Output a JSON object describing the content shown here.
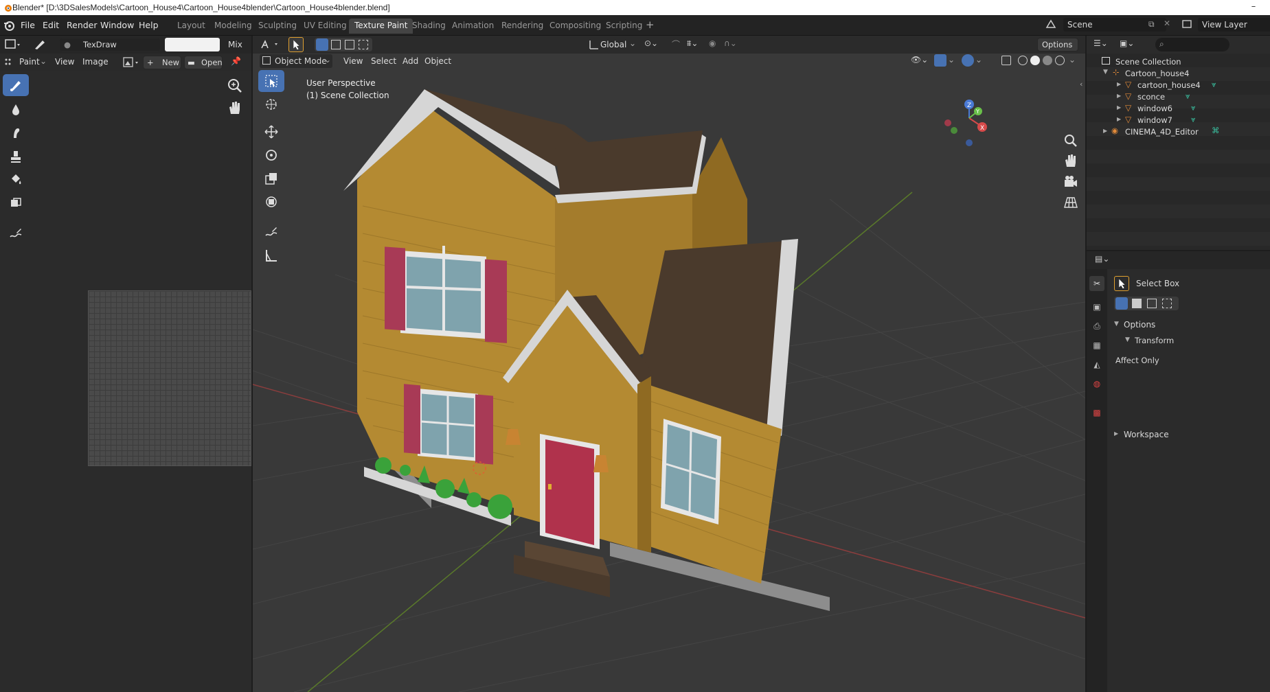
{
  "window": {
    "title": "Blender* [D:\\3DSalesModels\\Cartoon_House4\\Cartoon_House4blender\\Cartoon_House4blender.blend]",
    "minimize": "–"
  },
  "menu": [
    "File",
    "Edit",
    "Render",
    "Window",
    "Help"
  ],
  "workspaces": [
    "Layout",
    "Modeling",
    "Sculpting",
    "UV Editing",
    "Texture Paint",
    "Shading",
    "Animation",
    "Rendering",
    "Compositing",
    "Scripting"
  ],
  "workspace_active": "Texture Paint",
  "add_workspace": "+",
  "scene_name": "Scene",
  "view_layer": "View Layer",
  "image_editor": {
    "brush_name": "TexDraw",
    "blend_mode": "Mix",
    "mode": "Paint",
    "view": "View",
    "image": "Image",
    "new": "New",
    "open": "Open"
  },
  "viewport": {
    "object_mode": "Object Mode",
    "menus": [
      "View",
      "Select",
      "Add",
      "Object"
    ],
    "transform_orientation": "Global",
    "options": "Options",
    "overlay_line1": "User Perspective",
    "overlay_line2": "(1) Scene Collection",
    "gizmo_axes": {
      "x": "X",
      "y": "Y",
      "z": "Z"
    }
  },
  "outliner": {
    "root": "Scene Collection",
    "items": [
      {
        "label": "Cartoon_house4",
        "level": 1
      },
      {
        "label": "cartoon_house4",
        "level": 2
      },
      {
        "label": "sconce",
        "level": 2
      },
      {
        "label": "window6",
        "level": 2
      },
      {
        "label": "window7",
        "level": 2
      },
      {
        "label": "CINEMA_4D_Editor",
        "level": 1
      }
    ]
  },
  "properties": {
    "tool_name": "Select Box",
    "options_label": "Options",
    "transform_label": "Transform",
    "affect_only": "Affect Only",
    "workspace_label": "Workspace"
  },
  "colors": {
    "accent": "#4772b3",
    "siding": "#b48a32",
    "roof": "#4a3a2c",
    "shutter": "#a83a56",
    "door": "#b0324c",
    "trim": "#d8d8d8",
    "glass": "#7fa3ad",
    "grass": "#3aa23a"
  }
}
